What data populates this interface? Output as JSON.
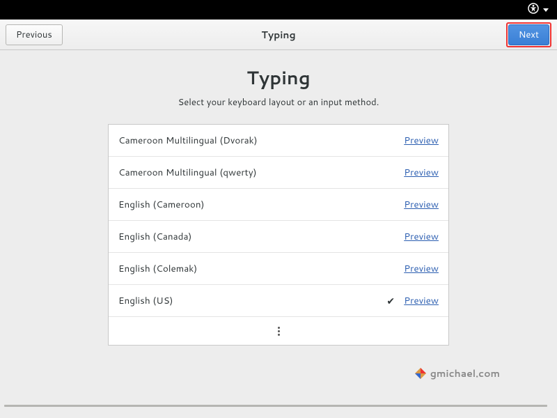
{
  "topbar": {},
  "header": {
    "previous": "Previous",
    "title": "Typing",
    "next": "Next"
  },
  "page": {
    "title": "Typing",
    "subtitle": "Select your keyboard layout or an input method.",
    "preview_label": "Preview",
    "layouts": [
      {
        "name": "Cameroon Multilingual (Dvorak)",
        "selected": false
      },
      {
        "name": "Cameroon Multilingual (qwerty)",
        "selected": false
      },
      {
        "name": "English (Cameroon)",
        "selected": false
      },
      {
        "name": "English (Canada)",
        "selected": false
      },
      {
        "name": "English (Colemak)",
        "selected": false
      },
      {
        "name": "English (US)",
        "selected": true
      }
    ]
  },
  "watermark": "gmichael.com"
}
